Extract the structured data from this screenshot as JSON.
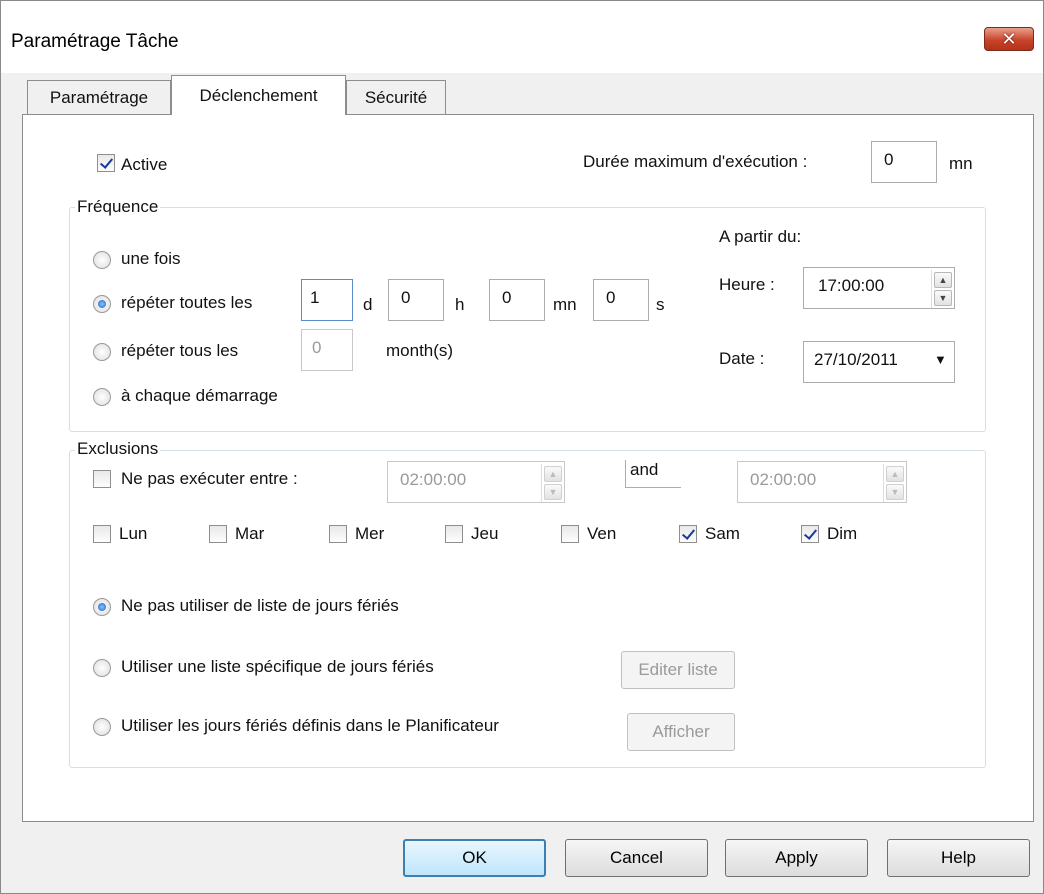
{
  "window": {
    "title": "Paramétrage Tâche",
    "close_icon": "close-icon",
    "accent_close": "#c8452b"
  },
  "tabs": [
    {
      "label": "Paramétrage",
      "active": false
    },
    {
      "label": "Déclenchement",
      "active": true
    },
    {
      "label": "Sécurité",
      "active": false
    }
  ],
  "active": {
    "label": "Active",
    "checked": true
  },
  "max_duration": {
    "label": "Durée maximum d'exécution :",
    "value": "0",
    "unit": "mn"
  },
  "frequence": {
    "legend": "Fréquence",
    "once_label": "une fois",
    "repeat_label": "répéter toutes les",
    "repeat_days": "1",
    "days_unit": "d",
    "repeat_hours": "0",
    "hours_unit": "h",
    "repeat_minutes": "0",
    "minutes_unit": "mn",
    "repeat_seconds": "0",
    "seconds_unit": "s",
    "monthly_label": "répéter tous les",
    "monthly_value": "0",
    "monthly_unit": "month(s)",
    "startup_label": "à chaque démarrage",
    "selected": "repeat"
  },
  "start": {
    "heading": "A partir du:",
    "time_label": "Heure :",
    "time_value": "17:00:00",
    "date_label": "Date :",
    "date_value": "27/10/2011"
  },
  "exclusions": {
    "legend": "Exclusions",
    "between_label": "Ne pas exécuter entre :",
    "between_checked": false,
    "from_value": "02:00:00",
    "and_label": "and",
    "to_value": "02:00:00",
    "days": [
      {
        "label": "Lun",
        "checked": false
      },
      {
        "label": "Mar",
        "checked": false
      },
      {
        "label": "Mer",
        "checked": false
      },
      {
        "label": "Jeu",
        "checked": false
      },
      {
        "label": "Ven",
        "checked": false
      },
      {
        "label": "Sam",
        "checked": true
      },
      {
        "label": "Dim",
        "checked": true
      }
    ],
    "holiday_none_label": "Ne pas utiliser de liste de jours fériés",
    "holiday_specific_label": "Utiliser une liste spécifique de jours fériés",
    "holiday_scheduler_label": "Utiliser les jours fériés définis dans le Planificateur",
    "edit_list_label": "Editer liste",
    "show_label": "Afficher",
    "holiday_selected": "none"
  },
  "buttons": {
    "ok": "OK",
    "cancel": "Cancel",
    "apply": "Apply",
    "help": "Help"
  }
}
